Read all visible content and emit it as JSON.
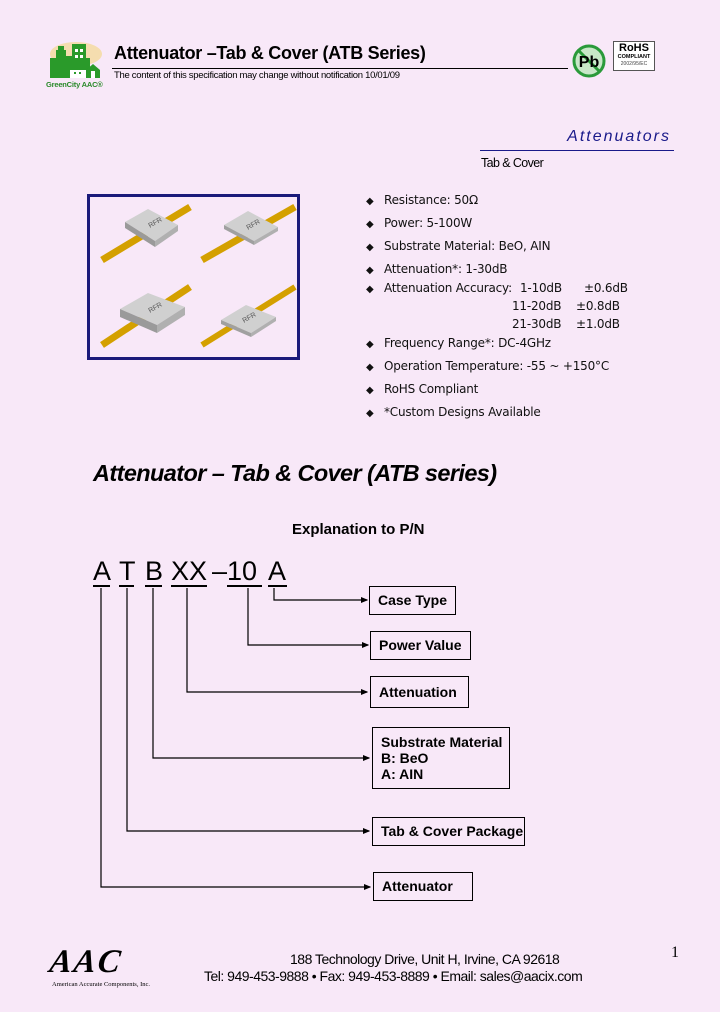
{
  "header": {
    "logo_text": "GreenCity AAC®",
    "title": "Attenuator –Tab & Cover (ATB Series)",
    "notice": "The content of this specification may change without notification 10/01/09",
    "pb_badge": "Pb",
    "rohs_badge": {
      "line1": "RoHS",
      "line2": "COMPLIANT",
      "line3": "2002/95/EC"
    }
  },
  "category": {
    "title": "Attenuators",
    "subtitle": "Tab & Cover"
  },
  "product_image": {
    "chip_label": "RFR"
  },
  "specs": {
    "bullet_icon": "◆",
    "items": [
      "Resistance: 50Ω",
      "Power: 5-100W",
      "Substrate Material: BeO, AIN",
      "Attenuation*: 1-30dB",
      "Attenuation Accuracy:",
      "Frequency Range*: DC-4GHz",
      "Operation Temperature: -55 ~ +150°C",
      "RoHS Compliant",
      "*Custom Designs Available"
    ],
    "accuracy": [
      {
        "range": "1-10dB",
        "tolerance": "±0.6dB"
      },
      {
        "range": "11-20dB",
        "tolerance": "±0.8dB"
      },
      {
        "range": "21-30dB",
        "tolerance": "±1.0dB"
      }
    ]
  },
  "section": {
    "title": "Attenuator – Tab & Cover (ATB series)",
    "pn_caption": "Explanation to P/N"
  },
  "part_number": {
    "chars": [
      "A",
      "T",
      "B",
      "XX",
      "–",
      "10",
      "A"
    ],
    "boxes": {
      "case_type": "Case Type",
      "power_value": "Power Value",
      "attenuation": "Attenuation",
      "substrate_title": "Substrate Material",
      "substrate_b": "B: BeO",
      "substrate_a": "A: AIN",
      "package": "Tab & Cover Package",
      "attenuator": "Attenuator"
    }
  },
  "footer": {
    "company_logo": "AAC",
    "company_name": "American Accurate Components, Inc.",
    "address": "188 Technology Drive, Unit H, Irvine, CA 92618",
    "contact": "Tel: 949-453-9888 • Fax: 949-453-8889 • Email: sales@aacix.com",
    "page_number": "1"
  },
  "colors": {
    "background": "#f8e8f8",
    "accent_blue": "#1a1a8a",
    "logo_green": "#2a8a2a",
    "tab_gold": "#d4a000",
    "chip_gray": "#c8c8c8"
  }
}
